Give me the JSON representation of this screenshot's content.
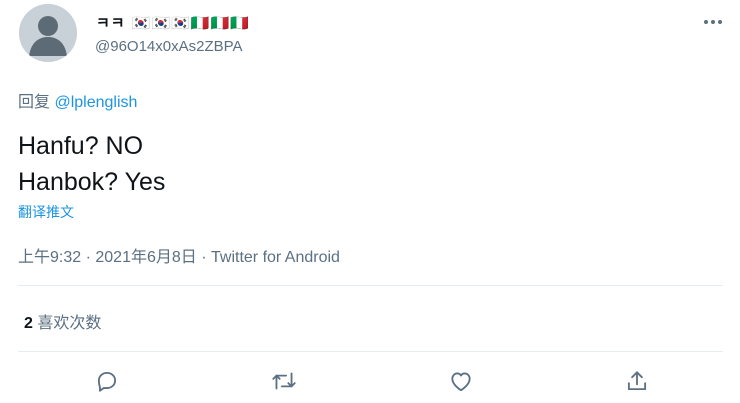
{
  "user": {
    "display_name": "ㅋㅋ 🇰🇷🇰🇷🇰🇷🇮🇹🇮🇹🇮🇹",
    "handle": "@96O14x0xAs2ZBPA"
  },
  "reply": {
    "prefix": "回复 ",
    "to": "@lplenglish"
  },
  "tweet": {
    "line1": "Hanfu? NO",
    "line2": "Hanbok? Yes",
    "translate_label": "翻译推文"
  },
  "meta": {
    "time": "上午9:32",
    "sep1": " · ",
    "date": "2021年6月8日",
    "sep2": " · ",
    "source": "Twitter for Android"
  },
  "stats": {
    "likes_count": "2",
    "likes_label": " 喜欢次数"
  },
  "actions": {
    "icons": [
      "reply-icon",
      "retweet-icon",
      "like-icon",
      "share-icon"
    ]
  },
  "colors": {
    "secondary_text": "#5b7083",
    "link": "#1b95e0",
    "divider": "#e6ecf0",
    "avatar_bg": "#c9d1d8"
  }
}
